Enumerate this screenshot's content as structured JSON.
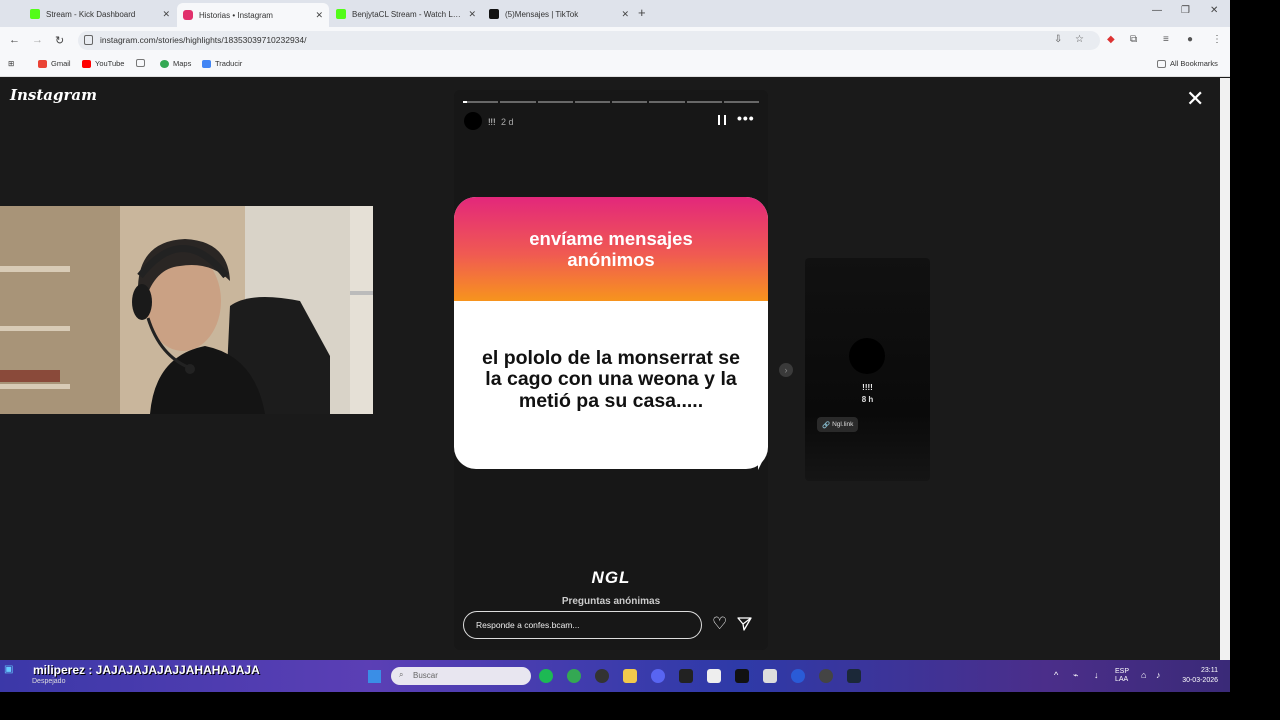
{
  "tabs": [
    {
      "label": "Stream - Kick Dashboard",
      "favicon_color": "#53fc18",
      "active": false
    },
    {
      "label": "Historias • Instagram",
      "favicon_color": "#e1306c",
      "active": true
    },
    {
      "label": "BenjytaCL Stream - Watch Live",
      "favicon_color": "#53fc18",
      "active": false
    },
    {
      "label": "(5)Mensajes | TikTok",
      "favicon_color": "#111111",
      "active": false
    }
  ],
  "address": {
    "url": "instagram.com/stories/highlights/18353039710232934/"
  },
  "bookmarks": {
    "items": [
      {
        "label": "Gmail",
        "color": "#ea4335"
      },
      {
        "label": "YouTube",
        "color": "#ff0000"
      },
      {
        "label": "",
        "color": "#777777"
      },
      {
        "label": "Maps",
        "color": "#34a853"
      },
      {
        "label": "Traducir",
        "color": "#4285f4"
      }
    ],
    "all_label": "All Bookmarks"
  },
  "page": {
    "logo": "Instagram",
    "story": {
      "segments": 8,
      "first_segment_progress": 0.12,
      "user": "!!!",
      "time": "2 d",
      "card_header": "envíame mensajes anónimos",
      "card_message": "el pololo de la monserrat se la cago con una weona y la metió pa su casa.....",
      "brand": "NGL",
      "brand_sub": "Preguntas anónimas",
      "reply_placeholder": "Responde a confes.bcam..."
    },
    "next_story": {
      "user": "!!!!",
      "time": "8 h",
      "link_label": "Ngl.link"
    }
  },
  "taskbar": {
    "chat_message": "miliperez : JAJAJAJAJAJJAHAHAJAJA",
    "weather": "Despejado",
    "search_placeholder": "Buscar",
    "lang_top": "ESP",
    "lang_bottom": "LAA",
    "time": "23:11",
    "date": "30-03-2026"
  }
}
